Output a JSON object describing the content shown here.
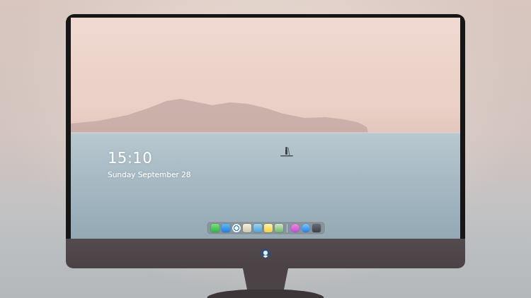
{
  "lock_screen": {
    "time": "15:10",
    "date": "Sunday September 28"
  }
}
